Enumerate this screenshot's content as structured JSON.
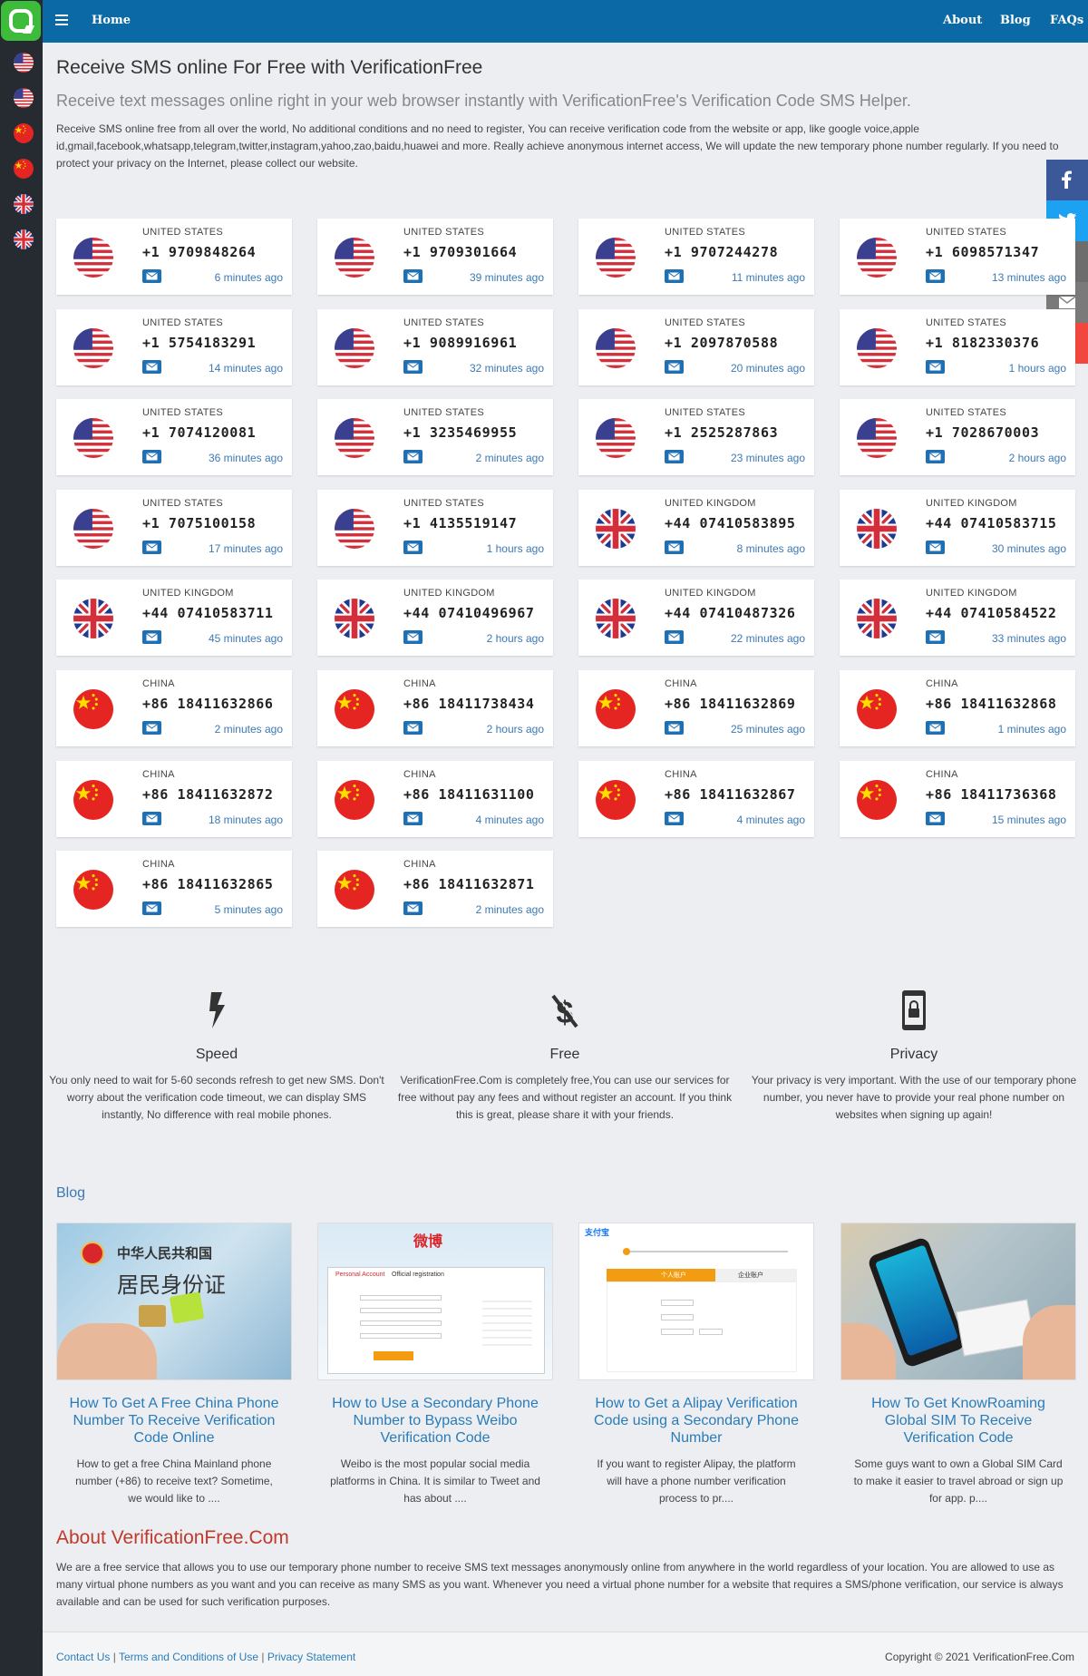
{
  "nav": {
    "home": "Home",
    "links": [
      "About",
      "Blog",
      "FAQs"
    ]
  },
  "header": {
    "title": "Receive SMS online For Free with VerificationFree",
    "subtitle": "Receive text messages online right in your web browser instantly with VerificationFree's Verification Code SMS Helper.",
    "intro": "Receive SMS online free from all over the world, No additional conditions and no need to register, You can receive verification code from the website or app, like google voice,apple id,gmail,facebook,whatsapp,telegram,twitter,instagram,yahoo,zao,baidu,huawei and more. Really achieve anonymous internet access, We will update the new temporary phone number regularly. If you need to protect your privacy on the Internet, please collect our website."
  },
  "sidebar_flags": [
    "us",
    "us",
    "cn",
    "cn",
    "uk",
    "uk"
  ],
  "share": {
    "count": "6",
    "buttons": [
      "facebook-icon",
      "twitter-icon",
      "print-icon",
      "email-icon",
      "plus-icon"
    ],
    "colors": [
      "#3b5998",
      "#1da1f2",
      "#6d6d6d",
      "#7a7a7a",
      "#f2473f"
    ]
  },
  "numbers": [
    {
      "flag": "us",
      "country": "UNITED STATES",
      "number": "+1 9709848264",
      "time": "6 minutes ago"
    },
    {
      "flag": "us",
      "country": "UNITED STATES",
      "number": "+1 9709301664",
      "time": "39 minutes ago"
    },
    {
      "flag": "us",
      "country": "UNITED STATES",
      "number": "+1 9707244278",
      "time": "11 minutes ago"
    },
    {
      "flag": "us",
      "country": "UNITED STATES",
      "number": "+1 6098571347",
      "time": "13 minutes ago"
    },
    {
      "flag": "us",
      "country": "UNITED STATES",
      "number": "+1 5754183291",
      "time": "14 minutes ago"
    },
    {
      "flag": "us",
      "country": "UNITED STATES",
      "number": "+1 9089916961",
      "time": "32 minutes ago"
    },
    {
      "flag": "us",
      "country": "UNITED STATES",
      "number": "+1 2097870588",
      "time": "20 minutes ago"
    },
    {
      "flag": "us",
      "country": "UNITED STATES",
      "number": "+1 8182330376",
      "time": "1 hours ago"
    },
    {
      "flag": "us",
      "country": "UNITED STATES",
      "number": "+1 7074120081",
      "time": "36 minutes ago"
    },
    {
      "flag": "us",
      "country": "UNITED STATES",
      "number": "+1 3235469955",
      "time": "2 minutes ago"
    },
    {
      "flag": "us",
      "country": "UNITED STATES",
      "number": "+1 2525287863",
      "time": "23 minutes ago"
    },
    {
      "flag": "us",
      "country": "UNITED STATES",
      "number": "+1 7028670003",
      "time": "2 hours ago"
    },
    {
      "flag": "us",
      "country": "UNITED STATES",
      "number": "+1 7075100158",
      "time": "17 minutes ago"
    },
    {
      "flag": "us",
      "country": "UNITED STATES",
      "number": "+1 4135519147",
      "time": "1 hours ago"
    },
    {
      "flag": "uk",
      "country": "UNITED KINGDOM",
      "number": "+44 07410583895",
      "time": "8 minutes ago"
    },
    {
      "flag": "uk",
      "country": "UNITED KINGDOM",
      "number": "+44 07410583715",
      "time": "30 minutes ago"
    },
    {
      "flag": "uk",
      "country": "UNITED KINGDOM",
      "number": "+44 07410583711",
      "time": "45 minutes ago"
    },
    {
      "flag": "uk",
      "country": "UNITED KINGDOM",
      "number": "+44 07410496967",
      "time": "2 hours ago"
    },
    {
      "flag": "uk",
      "country": "UNITED KINGDOM",
      "number": "+44 07410487326",
      "time": "22 minutes ago"
    },
    {
      "flag": "uk",
      "country": "UNITED KINGDOM",
      "number": "+44 07410584522",
      "time": "33 minutes ago"
    },
    {
      "flag": "cn",
      "country": "CHINA",
      "number": "+86 18411632866",
      "time": "2 minutes ago"
    },
    {
      "flag": "cn",
      "country": "CHINA",
      "number": "+86 18411738434",
      "time": "2 hours ago"
    },
    {
      "flag": "cn",
      "country": "CHINA",
      "number": "+86 18411632869",
      "time": "25 minutes ago"
    },
    {
      "flag": "cn",
      "country": "CHINA",
      "number": "+86 18411632868",
      "time": "1 minutes ago"
    },
    {
      "flag": "cn",
      "country": "CHINA",
      "number": "+86 18411632872",
      "time": "18 minutes ago"
    },
    {
      "flag": "cn",
      "country": "CHINA",
      "number": "+86 18411631100",
      "time": "4 minutes ago"
    },
    {
      "flag": "cn",
      "country": "CHINA",
      "number": "+86 18411632867",
      "time": "4 minutes ago"
    },
    {
      "flag": "cn",
      "country": "CHINA",
      "number": "+86 18411736368",
      "time": "15 minutes ago"
    },
    {
      "flag": "cn",
      "country": "CHINA",
      "number": "+86 18411632865",
      "time": "5 minutes ago"
    },
    {
      "flag": "cn",
      "country": "CHINA",
      "number": "+86 18411632871",
      "time": "2 minutes ago"
    }
  ],
  "features": [
    {
      "icon": "lightning-icon",
      "title": "Speed",
      "desc": "You only need to wait for 5-60 seconds refresh to get new SMS. Don't worry about the verification code timeout, we can display SMS instantly, No difference with real mobile phones."
    },
    {
      "icon": "dollar-off-icon",
      "title": "Free",
      "desc": "VerificationFree.Com is completely free,You can use our services for free without pay any fees and without register an account. If you think this is great, please share it with your friends."
    },
    {
      "icon": "phone-lock-icon",
      "title": "Privacy",
      "desc": "Your privacy is very important. With the use of our temporary phone number, you never have to provide your real phone number on websites when signing up again!"
    }
  ],
  "blog": {
    "title": "Blog",
    "posts": [
      {
        "title": "How To Get A Free China Phone Number To Receive Verification Code Online",
        "desc": "How to get a free China Mainland phone number (+86) to receive text? Sometime, we would like to ....",
        "image": "china-id-card-image",
        "img_text": [
          "中华人民共和国",
          "居民身份证"
        ]
      },
      {
        "title": "How to Use a Secondary Phone Number to Bypass Weibo Verification Code",
        "desc": "Weibo is the most popular social media platforms in China. It is similar to Tweet and has about ....",
        "image": "weibo-registration-image",
        "img_text": [
          "微博",
          "Personal Account",
          "Official registration"
        ]
      },
      {
        "title": "How to Get a Alipay Verification Code using a Secondary Phone Number",
        "desc": "If you want to register Alipay, the platform will have a phone number verification process to pr....",
        "image": "alipay-registration-image",
        "img_text": [
          "支付宝",
          "个人账户",
          "企业账户"
        ]
      },
      {
        "title": "How To Get KnowRoaming Global SIM To Receive Verification Code",
        "desc": "Some guys want to own a Global SIM Card to make it easier to travel abroad or sign up for app. p....",
        "image": "knowroaming-sim-image",
        "img_text": []
      }
    ]
  },
  "about": {
    "title": "About VerificationFree.Com",
    "text": "We are a free service that allows you to use our temporary phone number to receive SMS text messages anonymously online from anywhere in the world regardless of your location. You are allowed to use as many virtual phone numbers as you want and you can receive as many SMS as you want. Whenever you need a virtual phone number for a website that requires a SMS/phone verification, our service is always available and can be used for such verification purposes."
  },
  "footer": {
    "links": [
      "Contact Us",
      "Terms and Conditions of Use",
      "Privacy Statement"
    ],
    "separator": "|",
    "copyright": "Copyright © 2021 VerificationFree.Com"
  }
}
